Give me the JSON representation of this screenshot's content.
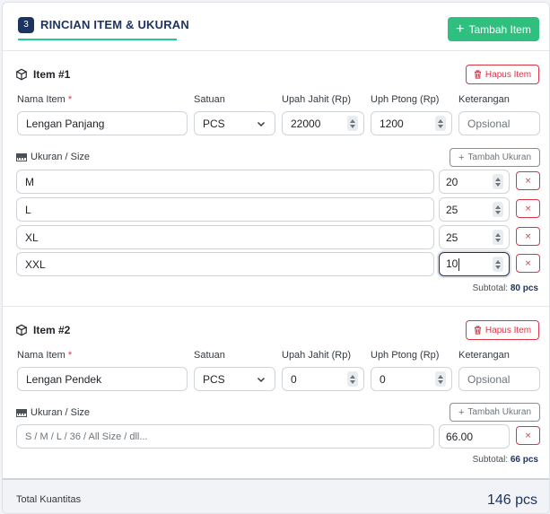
{
  "section": {
    "step": "3",
    "title": "RINCIAN ITEM & UKURAN",
    "add_item_label": "Tambah Item"
  },
  "labels": {
    "item_name": "Nama Item",
    "required_mark": "*",
    "unit": "Satuan",
    "sewing_wage": "Upah Jahit (Rp)",
    "cutting_wage": "Uph Ptong (Rp)",
    "notes": "Keterangan",
    "size": "Ukuran / Size",
    "add_size": "Tambah Ukuran",
    "remove_item": "Hapus Item",
    "subtotal": "Subtotal:",
    "remove_size": "×"
  },
  "items": [
    {
      "title": "Item #1",
      "name": "Lengan Panjang",
      "unit": "PCS",
      "sewing_wage": "22000",
      "cutting_wage": "1200",
      "notes_placeholder": "Opsional",
      "sizes": [
        {
          "name": "M",
          "qty": "20"
        },
        {
          "name": "L",
          "qty": "25"
        },
        {
          "name": "XL",
          "qty": "25"
        },
        {
          "name": "XXL",
          "qty": "10"
        }
      ],
      "subtotal": "80 pcs"
    },
    {
      "title": "Item #2",
      "name": "Lengan Pendek",
      "unit": "PCS",
      "sewing_wage": "0",
      "cutting_wage": "0",
      "notes_placeholder": "Opsional",
      "sizes": [
        {
          "name_placeholder": "S / M / L / 36 / All Size / dll...",
          "qty": "66.00"
        }
      ],
      "subtotal": "66 pcs"
    }
  ],
  "footer": {
    "total_label": "Total Kuantitas",
    "total_value": "146 pcs"
  },
  "colors": {
    "primary": "#1d3461",
    "success": "#2fbf7f",
    "danger": "#dc3545",
    "accent_underline": "#20c997"
  },
  "icons": {
    "item": "box-icon",
    "remove": "trash-icon",
    "size": "ruler-icon",
    "add": "plus-icon",
    "select": "chevron-down-icon"
  }
}
